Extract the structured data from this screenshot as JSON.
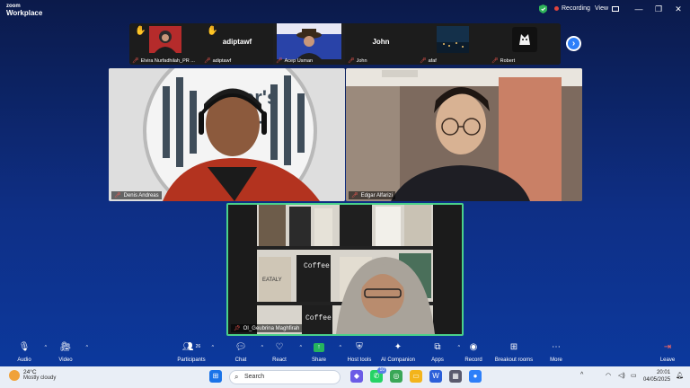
{
  "app": {
    "brand_line1": "zoom",
    "brand_line2": "Workplace"
  },
  "topbar": {
    "recording_label": "Recording",
    "view_label": "View"
  },
  "thumbnails": [
    {
      "name": "Elvira Nurfadhilah_PR ...",
      "big_name": "",
      "hand_raised": true
    },
    {
      "name": "adiptawf",
      "big_name": "adiptawf",
      "hand_raised": true
    },
    {
      "name": "Acep Usman",
      "big_name": "",
      "hand_raised": false
    },
    {
      "name": "John",
      "big_name": "John",
      "hand_raised": false
    },
    {
      "name": "afaf",
      "big_name": "",
      "hand_raised": false
    },
    {
      "name": "Robert",
      "big_name": "",
      "hand_raised": false
    }
  ],
  "tiles": {
    "denis": {
      "name": "Denis Andreas"
    },
    "edgar": {
      "name": "Edgar Alfarizi"
    },
    "oi": {
      "name": "OI_Geubrina Maghfirah",
      "book_1": "Coffee",
      "book_2": "EATALY",
      "book_3": "Coffee"
    }
  },
  "toolbar": {
    "audio": "Audio",
    "video": "Video",
    "participants": "Participants",
    "participants_count": "26",
    "chat": "Chat",
    "react": "React",
    "share": "Share",
    "host_tools": "Host tools",
    "ai_companion": "AI Companion",
    "apps": "Apps",
    "record": "Record",
    "breakout": "Breakout rooms",
    "more": "More",
    "leave": "Leave"
  },
  "taskbar": {
    "weather_temp": "24°C",
    "weather_desc": "Mostly cloudy",
    "search_placeholder": "Search",
    "whatsapp_badge": "10",
    "time": "20:01",
    "date": "04/05/2025"
  },
  "colors": {
    "accent": "#2d7ff9",
    "active_speaker": "#4ad18a",
    "recording": "#e0443e",
    "share": "#25b45e"
  }
}
